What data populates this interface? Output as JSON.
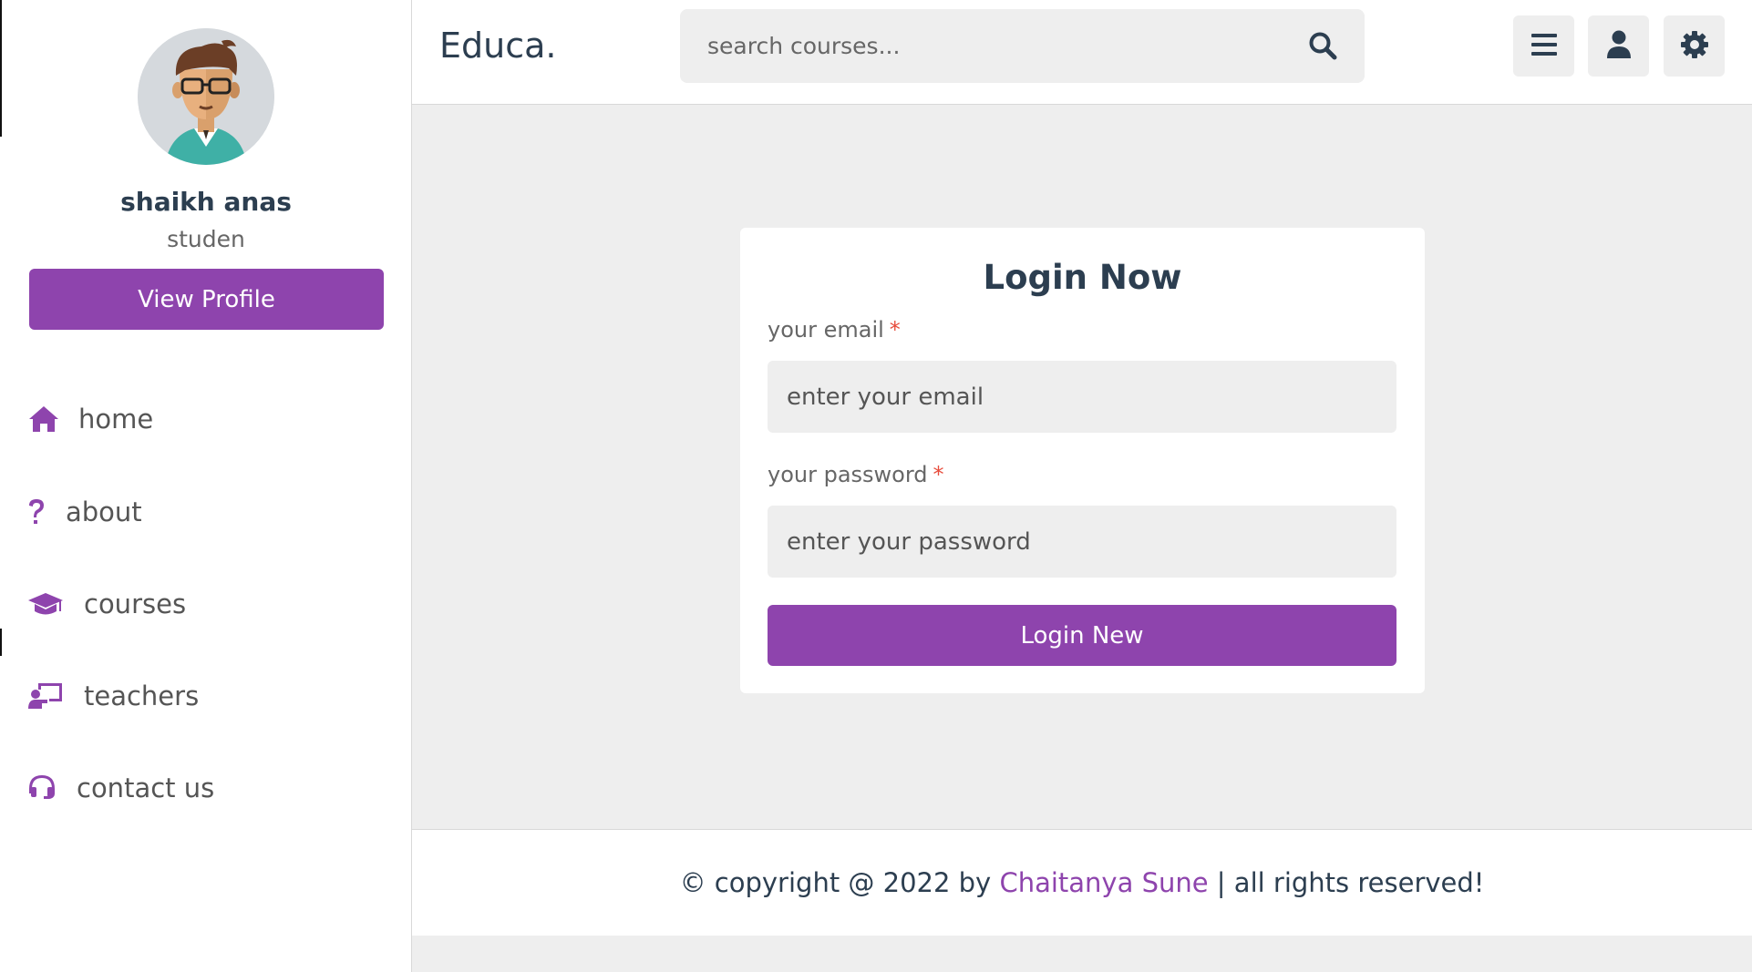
{
  "header": {
    "logo": "Educa.",
    "search_placeholder": "search courses...",
    "menu_icon": "bars-icon",
    "user_icon": "user-icon",
    "settings_icon": "gear-icon"
  },
  "sidebar": {
    "profile": {
      "name": "shaikh anas",
      "role": "studen",
      "view_profile_label": "View Profile"
    },
    "items": [
      {
        "label": "home",
        "icon": "home-icon"
      },
      {
        "label": "about",
        "icon": "question-icon"
      },
      {
        "label": "courses",
        "icon": "graduation-cap-icon"
      },
      {
        "label": "teachers",
        "icon": "chalkboard-teacher-icon"
      },
      {
        "label": "contact us",
        "icon": "headset-icon"
      }
    ]
  },
  "login": {
    "title": "Login Now",
    "email_label": "your email",
    "email_placeholder": "enter your email",
    "password_label": "your password",
    "password_placeholder": "enter your password",
    "required_mark": "*",
    "submit_label": "Login New"
  },
  "footer": {
    "prefix": "© copyright @ 2022 by ",
    "author": "Chaitanya Sune",
    "suffix": " | all rights reserved!"
  },
  "colors": {
    "accent": "#8e44ad",
    "background": "#eeeeee",
    "text": "#2c3e50",
    "required": "#e74c3c"
  }
}
